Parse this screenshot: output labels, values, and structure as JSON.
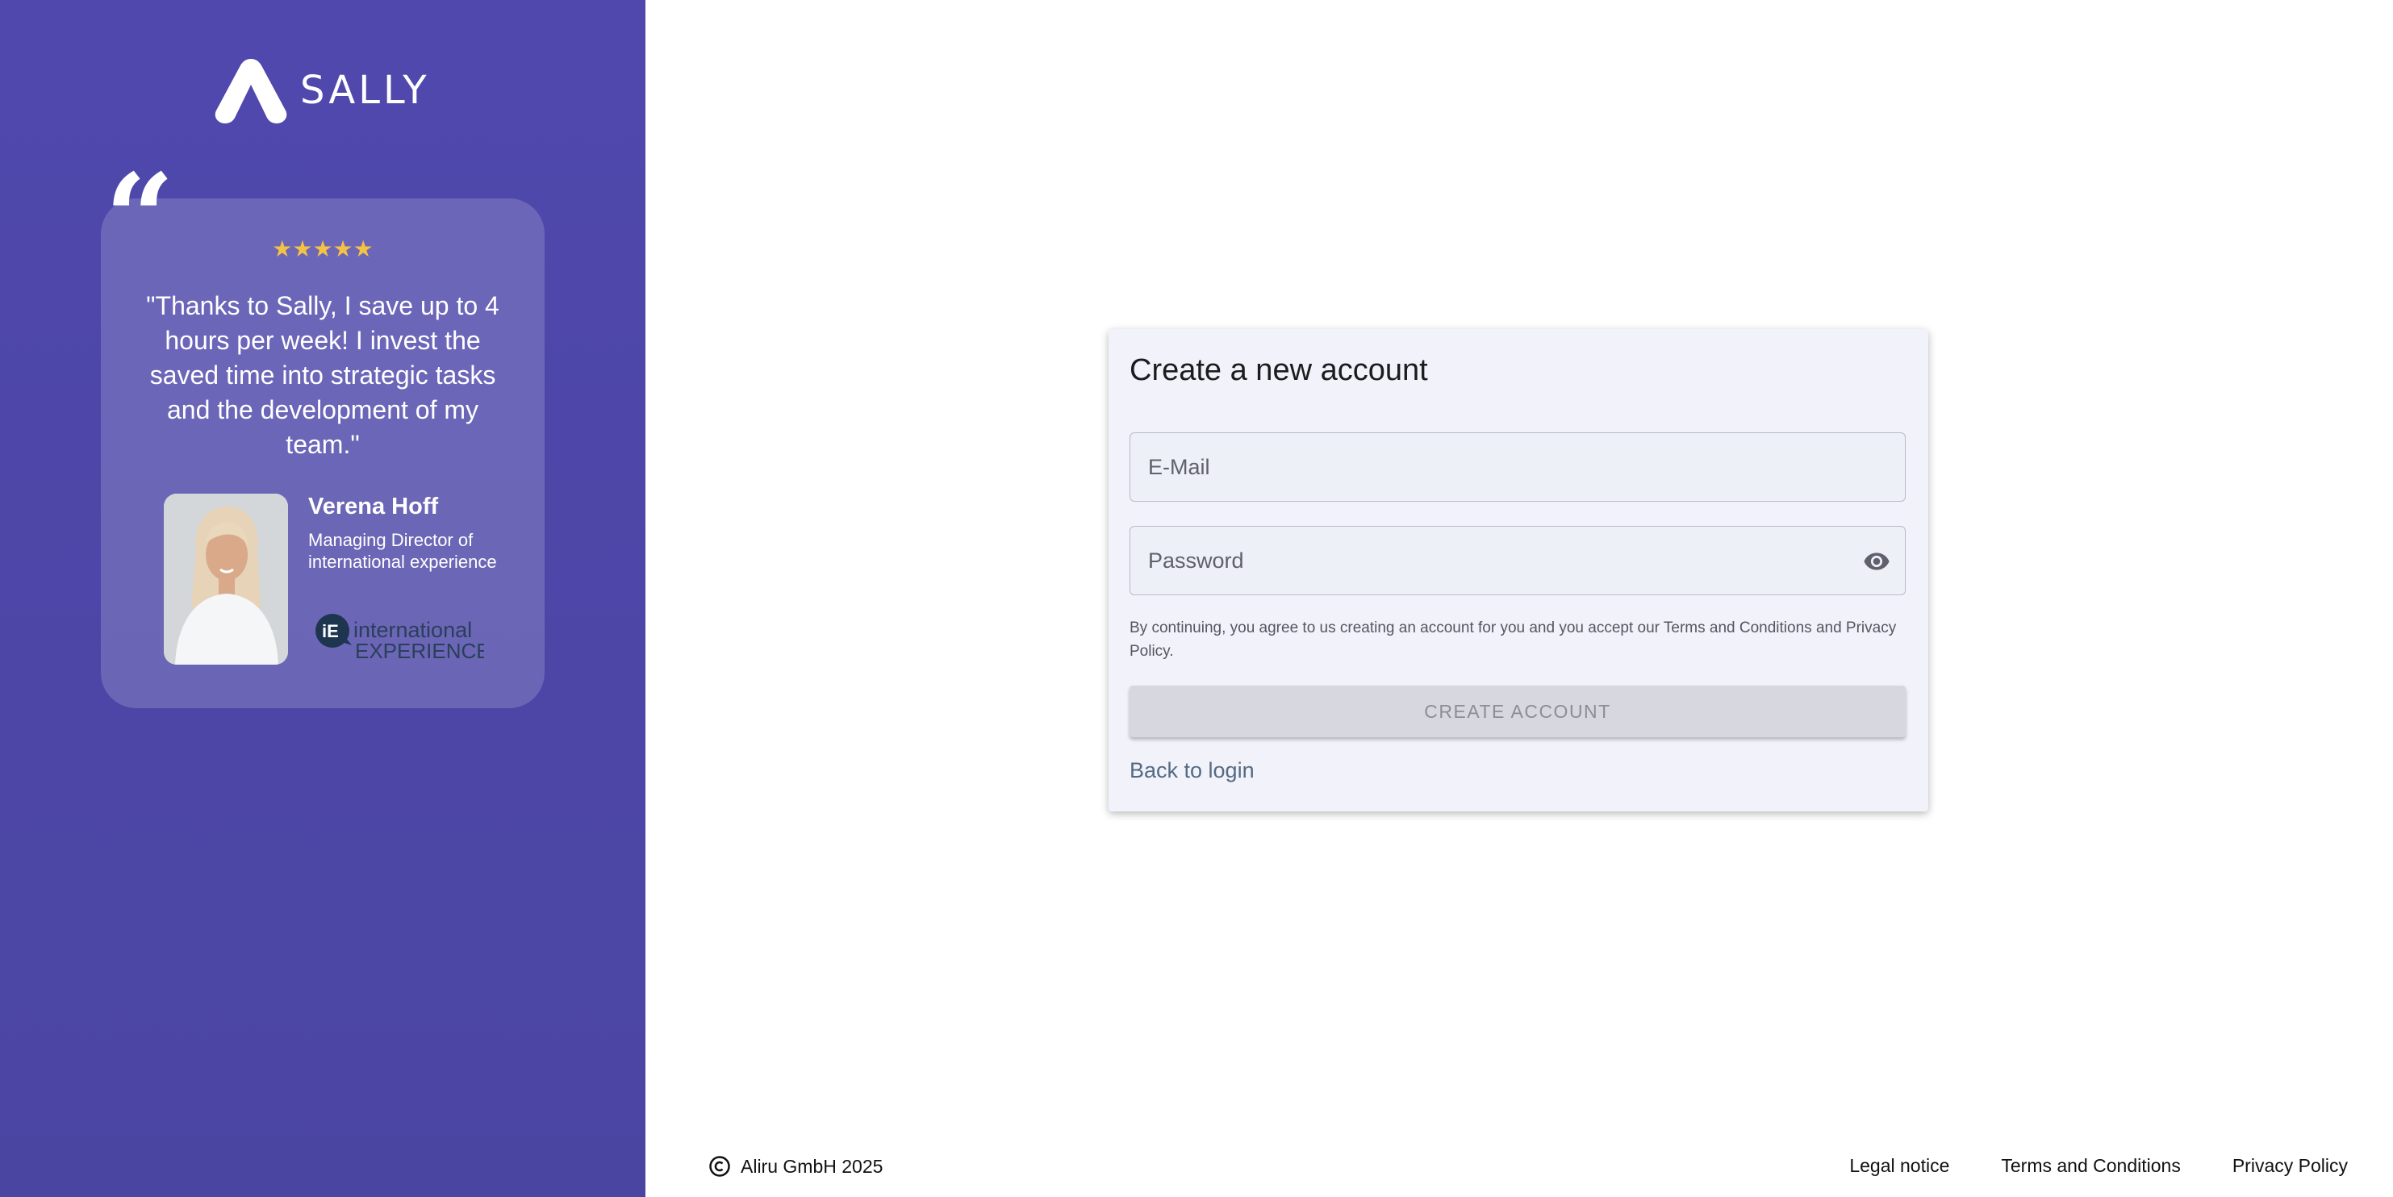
{
  "brand": {
    "name": "SALLY"
  },
  "testimonial": {
    "rating": 5,
    "stars": "★★★★★",
    "quote": "\"Thanks to Sally, I save up to 4 hours per week! I invest the saved time into strategic tasks and the development of my team.\"",
    "name": "Verena Hoff",
    "role": "Managing Director of international experience",
    "company_logo_text_1": "international",
    "company_logo_text_2": "EXPERIENCE",
    "company_logo_mark": "iE"
  },
  "form": {
    "title": "Create a new account",
    "email_placeholder": "E-Mail",
    "password_placeholder": "Password",
    "terms_text": "By continuing, you agree to us creating an account for you and you accept our Terms and Conditions and Privacy Policy.",
    "submit_label": "CREATE ACCOUNT",
    "back_label": "Back to login"
  },
  "footer": {
    "copyright": "Aliru GmbH 2025",
    "links": [
      "Legal notice",
      "Terms and Conditions",
      "Privacy Policy"
    ]
  },
  "colors": {
    "panel": "#4f48ab",
    "star": "#f4c244",
    "form_bg": "#f1f2fa",
    "button_disabled": "#d7d7df",
    "link": "#556a82"
  }
}
